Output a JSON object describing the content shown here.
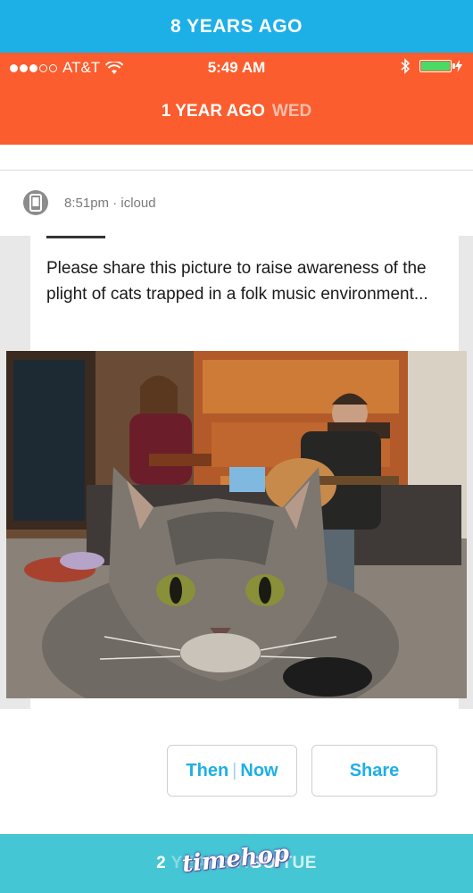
{
  "top_banner": {
    "label": "8 YEARS AGO",
    "color": "#1db0e6"
  },
  "header": {
    "color": "#fb5d2e",
    "status_bar": {
      "carrier": "AT&T",
      "time": "5:49 AM",
      "signal_bars_filled": 3,
      "signal_bars_total": 5,
      "bluetooth": true,
      "battery_level": 1.0,
      "icons": [
        "wifi-icon",
        "bluetooth-icon",
        "battery-icon",
        "charging-icon"
      ]
    },
    "section_title": "1 YEAR AGO",
    "section_day": "WED"
  },
  "card": {
    "source": {
      "time": "8:51pm",
      "separator": "·",
      "app": "icloud",
      "icon": "phone-icon"
    },
    "post_text": "Please share this picture to raise awareness of the plight of cats trapped in a folk music environment...",
    "photo_description_icon": "photo"
  },
  "actions": {
    "then": "Then",
    "separator": "|",
    "now": "Now",
    "share": "Share",
    "accent": "#1db0e6"
  },
  "bottom_banner": {
    "prefix": "2",
    "hidden_part": "YEARS A",
    "suffix": "GO",
    "day": "TUE",
    "color": "#45c6d4",
    "watermark": "timehop"
  }
}
